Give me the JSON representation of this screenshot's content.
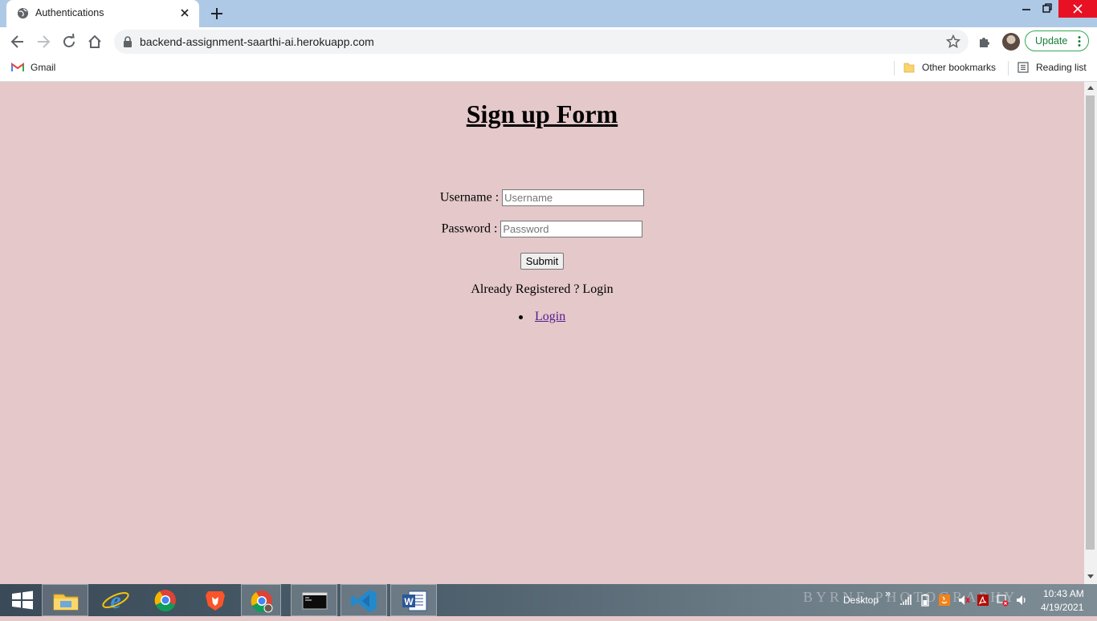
{
  "browser": {
    "tab": {
      "title": "Authentications"
    },
    "address_bar": {
      "url": "backend-assignment-saarthi-ai.herokuapp.com"
    },
    "update_button": {
      "label": "Update"
    },
    "bookmarks": {
      "gmail": "Gmail",
      "other": "Other bookmarks",
      "reading_list": "Reading list"
    }
  },
  "page": {
    "title": "Sign up Form",
    "username": {
      "label": "Username :",
      "placeholder": "Username",
      "value": ""
    },
    "password": {
      "label": "Password :",
      "placeholder": "Password",
      "value": ""
    },
    "submit_label": "Submit",
    "already_text": "Already Registered ? Login",
    "login_link": "Login",
    "background_color": "#e4c8ca"
  },
  "taskbar": {
    "apps": [
      "start-icon",
      "file-explorer-icon",
      "internet-explorer-icon",
      "chrome-icon",
      "brave-icon",
      "chrome-profile-icon",
      "cmd-icon",
      "vscode-icon",
      "word-icon"
    ],
    "desktop_label": "Desktop",
    "watermark": "BYRNE PHOTOGRAPHY",
    "time": "10:43 AM",
    "date": "4/19/2021"
  }
}
